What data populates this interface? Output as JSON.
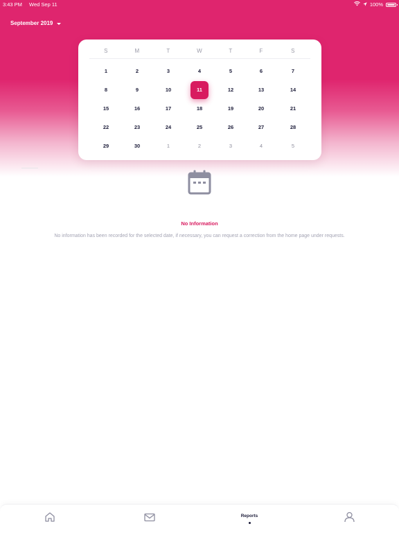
{
  "status_bar": {
    "time": "3:43 PM",
    "date": "Wed Sep 11",
    "battery": "100%",
    "icons": [
      "wifi-icon",
      "location-arrow-icon",
      "battery-icon"
    ]
  },
  "header": {
    "month_label": "September 2019",
    "dropdown_icon": "caret-down-icon",
    "accent_color": "#df256e"
  },
  "calendar": {
    "weekdays": [
      "S",
      "M",
      "T",
      "W",
      "T",
      "F",
      "S"
    ],
    "weeks": [
      [
        "1",
        "2",
        "3",
        "4",
        "5",
        "6",
        "7"
      ],
      [
        "8",
        "9",
        "10",
        "11",
        "12",
        "13",
        "14"
      ],
      [
        "15",
        "16",
        "17",
        "18",
        "19",
        "20",
        "21"
      ],
      [
        "22",
        "23",
        "24",
        "25",
        "26",
        "27",
        "28"
      ],
      [
        "29",
        "30",
        "1",
        "2",
        "3",
        "4",
        "5"
      ]
    ],
    "selected": "11",
    "selected_color": "#d81b5f"
  },
  "empty_state": {
    "icon": "calendar-icon",
    "title": "No Information",
    "message": "No information has been recorded for the selected date, if necessary, you can request a correction from the home page under requests."
  },
  "tab_bar": {
    "items": [
      {
        "icon": "home-icon",
        "label": ""
      },
      {
        "icon": "mail-icon",
        "label": ""
      },
      {
        "icon": "",
        "label": "Reports",
        "active": true
      },
      {
        "icon": "profile-icon",
        "label": ""
      }
    ]
  }
}
